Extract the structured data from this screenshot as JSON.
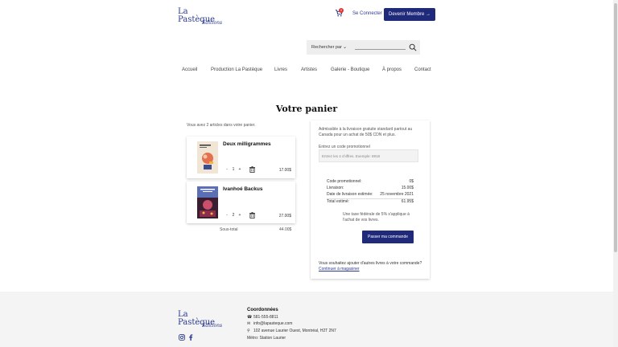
{
  "header": {
    "logo": {
      "line1": "La",
      "line2": "Pastèque",
      "line3": "Éditions"
    },
    "cart_count": "0",
    "login_label": "Se Connecter",
    "member_label": "Devenir Membre →",
    "search": {
      "category_label": "Rechercher par",
      "chevron": "⌄"
    }
  },
  "nav": {
    "items": [
      {
        "label": "Accueil"
      },
      {
        "label": "Production La Pastèque"
      },
      {
        "label": "Livres"
      },
      {
        "label": "Artistes"
      },
      {
        "label": "Galerie - Boutique"
      },
      {
        "label": "À propos"
      },
      {
        "label": "Contact"
      }
    ]
  },
  "cart": {
    "title": "Votre panier",
    "count_text": "Vous avez 2 articles dans votre panier.",
    "items": [
      {
        "title": "Deux milligrammes",
        "qty": "1",
        "minus": "-",
        "plus": "+",
        "price": "17.00$"
      },
      {
        "title": "Ivanhoé Backus",
        "qty": "2",
        "minus": "-",
        "plus": "+",
        "price": "27.00$"
      }
    ],
    "subtotal_label": "Sous-total",
    "subtotal_value": "44.00$"
  },
  "summary": {
    "free_shipping": "Admissible à la livraison gratuite standard partout au Canada pour un achat de 50$ CDN et plus.",
    "promo_label": "Entrez un code promotionnel",
    "promo_placeholder": "Entrez les 4 chiffres. Exemple: 8918",
    "rows": [
      {
        "label": "Code promotionnel:",
        "value": "0$"
      },
      {
        "label": "Livraison:",
        "value": "15.00$"
      },
      {
        "label": "Date de livraison estimée:",
        "value": "25 novembre 2021"
      },
      {
        "label": "Total estimé:",
        "value": "61.95$"
      }
    ],
    "tax_note": "Une taxe fédérale de 5% s'applique à l'achat de vos livres.",
    "order_button": "Passer ma commande",
    "more_books": "Vous souhaitez ajouter d'autres livres à votre commande?",
    "continue_link": "Continuer à magasiner"
  },
  "footer": {
    "logo": {
      "line1": "La",
      "line2": "Pastèque",
      "line3": "Éditions"
    },
    "title": "Coordonnées",
    "phone": "581-555-8811",
    "email": "info@lapasteque.com",
    "address": "102 avenue Laurier Ouest, Montréal, H2T 2N7",
    "metro": "Métro: Station Laurier"
  },
  "colors": {
    "brand": "#1f2a7a",
    "logo": "#2b3a8f",
    "badge": "#e0322f"
  }
}
